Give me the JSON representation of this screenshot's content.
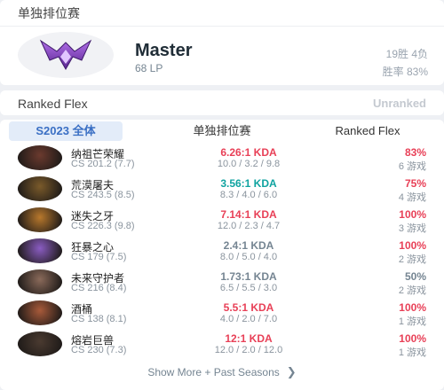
{
  "solo": {
    "title": "单独排位赛",
    "tier": "Master",
    "lp": "68 LP",
    "winloss": "19胜 4负",
    "winrate": "胜率 83%",
    "emblem_icon": "master-emblem-icon",
    "emblem_color": "#8a46c9"
  },
  "flex": {
    "title": "Ranked Flex",
    "status": "Unranked"
  },
  "champions": {
    "tabs": [
      "S2023 全体",
      "单独排位赛",
      "Ranked Flex"
    ],
    "active_tab": 0,
    "rows": [
      {
        "name": "纳祖芒荣耀",
        "cs": "CS 201.2 (7.7)",
        "kda": "6.26:1 KDA",
        "kda_color": "#e84057",
        "kda_detail": "10.0 / 3.2 / 9.8",
        "wr": "83%",
        "wr_color": "#e84057",
        "games": "6 游戏",
        "avatar_color": "#6b3a2e"
      },
      {
        "name": "荒漠屠夫",
        "cs": "CS 243.5 (8.5)",
        "kda": "3.56:1 KDA",
        "kda_color": "#0fa3a0",
        "kda_detail": "8.3 / 4.0 / 6.0",
        "wr": "75%",
        "wr_color": "#e84057",
        "games": "4 游戏",
        "avatar_color": "#7a5a2a"
      },
      {
        "name": "迷失之牙",
        "cs": "CS 226.3 (9.8)",
        "kda": "7.14:1 KDA",
        "kda_color": "#e84057",
        "kda_detail": "12.0 / 2.3 / 4.7",
        "wr": "100%",
        "wr_color": "#e84057",
        "games": "3 游戏",
        "avatar_color": "#b8782c"
      },
      {
        "name": "狂暴之心",
        "cs": "CS 179 (7.5)",
        "kda": "2.4:1 KDA",
        "kda_color": "#758592",
        "kda_detail": "8.0 / 5.0 / 4.0",
        "wr": "100%",
        "wr_color": "#e84057",
        "games": "2 游戏",
        "avatar_color": "#8a5cc2"
      },
      {
        "name": "未来守护者",
        "cs": "CS 216 (8.4)",
        "kda": "1.73:1 KDA",
        "kda_color": "#758592",
        "kda_detail": "6.5 / 5.5 / 3.0",
        "wr": "50%",
        "wr_color": "#758592",
        "games": "2 游戏",
        "avatar_color": "#8a6a5a"
      },
      {
        "name": "酒桶",
        "cs": "CS 138 (8.1)",
        "kda": "5.5:1 KDA",
        "kda_color": "#e84057",
        "kda_detail": "4.0 / 2.0 / 7.0",
        "wr": "100%",
        "wr_color": "#e84057",
        "games": "1 游戏",
        "avatar_color": "#a85a3a"
      },
      {
        "name": "熔岩巨兽",
        "cs": "CS 230 (7.3)",
        "kda": "12:1 KDA",
        "kda_color": "#e84057",
        "kda_detail": "12.0 / 2.0 / 12.0",
        "wr": "100%",
        "wr_color": "#e84057",
        "games": "1 游戏",
        "avatar_color": "#4a3a30"
      }
    ],
    "show_more": "Show More + Past Seasons",
    "show_more_icon": "chevron-right-icon"
  }
}
